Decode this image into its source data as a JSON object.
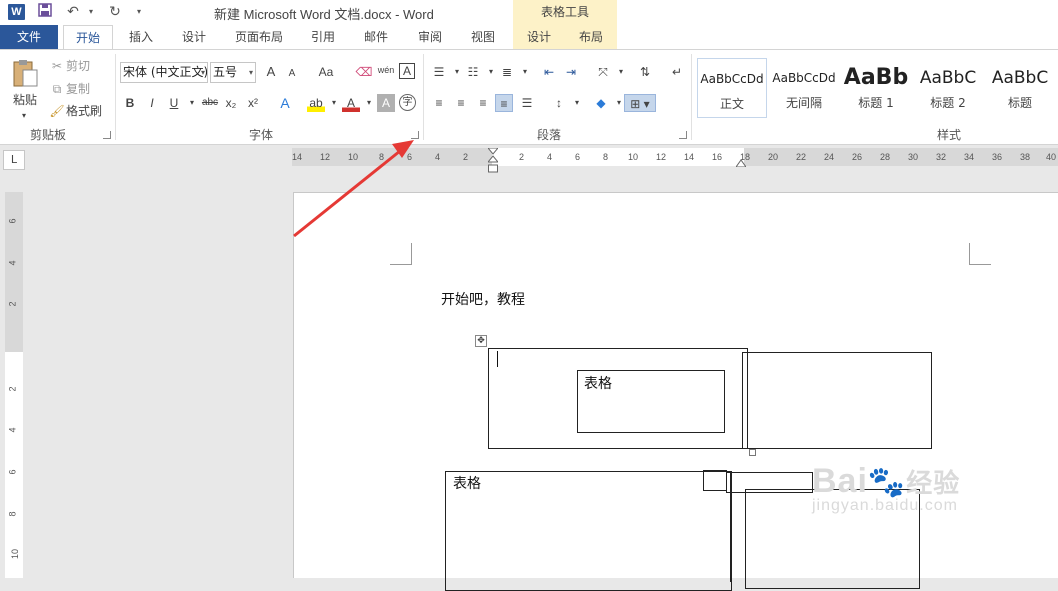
{
  "titlebar": {
    "app_icon": "W",
    "title": "新建 Microsoft Word 文档.docx - Word",
    "contextual_header": "表格工具",
    "save_icon": "save-icon",
    "undo_icon": "undo-icon",
    "redo_icon": "redo-icon",
    "customize_icon": "customize-icon"
  },
  "tabs": [
    "文件",
    "开始",
    "插入",
    "设计",
    "页面布局",
    "引用",
    "邮件",
    "审阅",
    "视图",
    "设计",
    "布局"
  ],
  "clipboard": {
    "paste": "粘贴",
    "cut": "剪切",
    "copy": "复制",
    "format_painter": "格式刷",
    "group": "剪贴板"
  },
  "font": {
    "name": "宋体 (中文正文)",
    "size": "五号",
    "grow": "A",
    "shrink": "A",
    "case": "Aa",
    "pinyin": "wén",
    "border_char": "A",
    "bold": "B",
    "italic": "I",
    "underline": "U",
    "strike": "abc",
    "sub": "x₂",
    "sup": "x²",
    "effects": "A",
    "highlight": "ab",
    "color": "A",
    "shading": "A",
    "enclose": "字",
    "group": "字体"
  },
  "paragraph": {
    "group": "段落"
  },
  "styles": {
    "items": [
      {
        "sample": "AaBbCcDd",
        "name": "正文"
      },
      {
        "sample": "AaBbCcDd",
        "name": "无间隔"
      },
      {
        "sample": "AaBb",
        "name": "标题 1"
      },
      {
        "sample": "AaBbC",
        "name": "标题 2"
      },
      {
        "sample": "AaBbC",
        "name": "标题"
      }
    ],
    "group": "样式"
  },
  "ruler": {
    "corner": "L",
    "left_labels": [
      "14",
      "12",
      "10",
      "8",
      "6",
      "4",
      "2"
    ],
    "right_labels": [
      "2",
      "4",
      "6",
      "8",
      "10",
      "12",
      "14",
      "16",
      "18",
      "20",
      "22",
      "24",
      "26",
      "28",
      "30",
      "32",
      "34",
      "36",
      "38",
      "40"
    ],
    "vertical_labels": [
      "6",
      "4",
      "2",
      "2",
      "4",
      "6",
      "8",
      "10"
    ]
  },
  "document": {
    "first_line": "开始吧，教程",
    "table_cell_1": "表格",
    "table_cell_2": "表格"
  },
  "watermark": {
    "brand": "Bai",
    "brand_cn": "经验",
    "url": "jingyan.baidu.com"
  },
  "colors": {
    "word_blue": "#2b579a",
    "table_tools": "#fdf2c8",
    "arrow_red": "#e53935"
  }
}
